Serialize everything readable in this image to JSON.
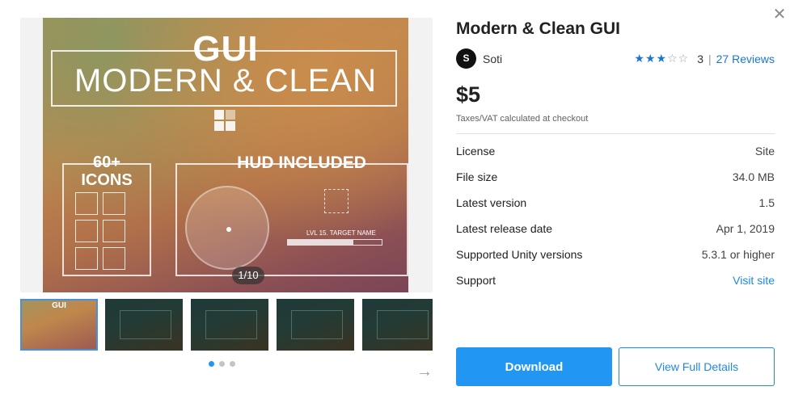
{
  "close_label": "✕",
  "gallery": {
    "hero": {
      "gui_text": "GUI",
      "subtitle": "MODERN & CLEAN",
      "icons_title": "60+ ICONS",
      "hud_title": "HUD INCLUDED",
      "lvl_text": "LVL 15. TARGET NAME"
    },
    "counter": "1/10",
    "thumb0_text": "GUI",
    "next_arrow": "→"
  },
  "product": {
    "title": "Modern & Clean GUI",
    "publisher_initial": "S",
    "publisher": "Soti",
    "rating": {
      "stars": 3,
      "max": 5,
      "count": "3",
      "separator": "|",
      "reviews": "27 Reviews"
    },
    "price": "$5",
    "tax_note": "Taxes/VAT calculated at checkout",
    "details": [
      {
        "key": "License",
        "value": "Site"
      },
      {
        "key": "File size",
        "value": "34.0 MB"
      },
      {
        "key": "Latest version",
        "value": "1.5"
      },
      {
        "key": "Latest release date",
        "value": "Apr 1, 2019"
      },
      {
        "key": "Supported Unity versions",
        "value": "5.3.1 or higher"
      },
      {
        "key": "Support",
        "value": "Visit site"
      }
    ]
  },
  "actions": {
    "download": "Download",
    "view_details": "View Full Details"
  },
  "colors": {
    "accent": "#2196f3",
    "link": "#1e88e5"
  }
}
